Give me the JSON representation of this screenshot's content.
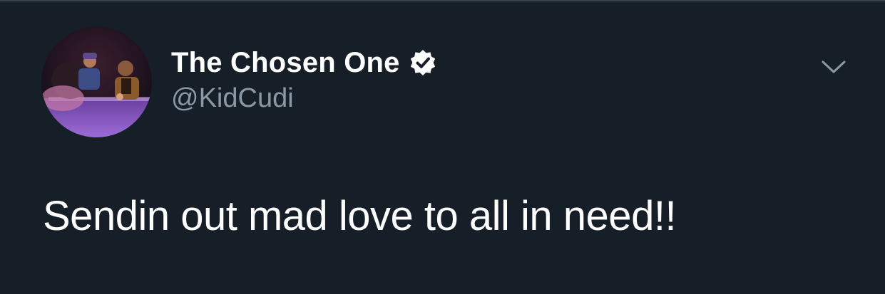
{
  "tweet": {
    "display_name": "The Chosen One",
    "handle": "@KidCudi",
    "text": "Sendin out mad love to all in need!!",
    "verified": true
  },
  "icons": {
    "verified": "verified-badge-icon",
    "menu": "chevron-down-icon",
    "avatar": "profile-photo"
  },
  "colors": {
    "background": "#161e28",
    "name": "#ffffff",
    "handle": "#8b98a5",
    "text": "#ffffff",
    "chevron": "#8b98a5",
    "divider": "#38444d"
  }
}
